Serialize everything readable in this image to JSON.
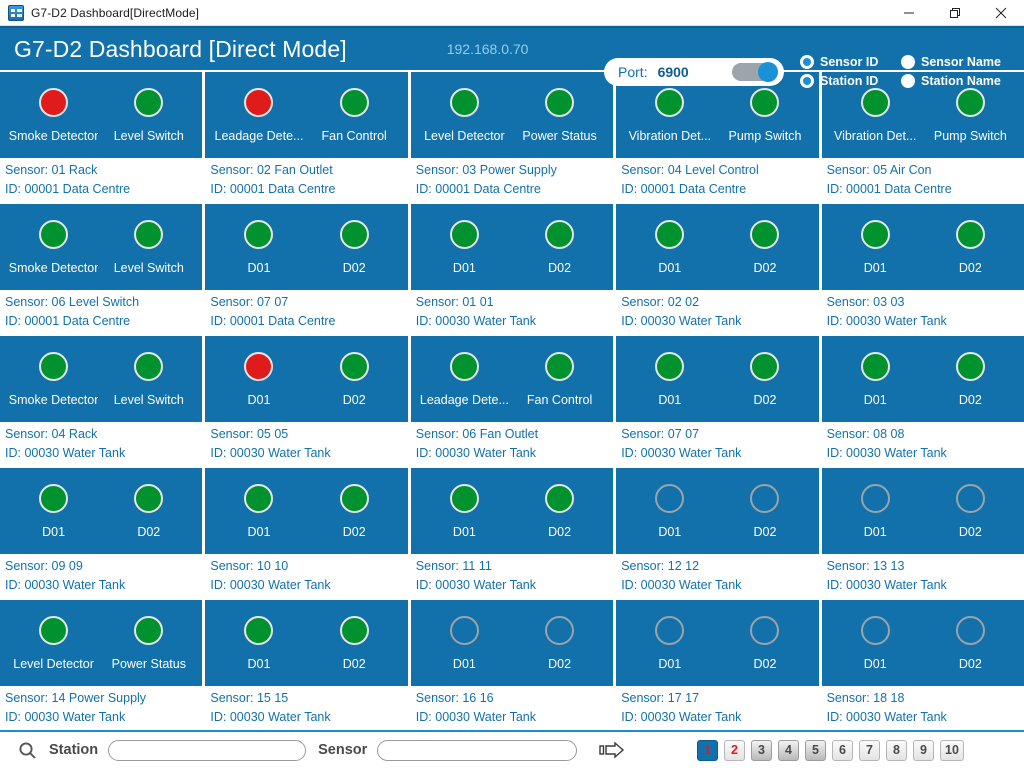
{
  "window": {
    "title": "G7-D2 Dashboard[DirectMode]",
    "app_icon": "app-window-icon",
    "minimize": "minimize-icon",
    "maximize": "maximize-icon",
    "close": "close-icon"
  },
  "header": {
    "title": "G7-D2 Dashboard [Direct Mode]",
    "ip_address": "192.168.0.70",
    "port_label": "Port:",
    "port_value": "6900",
    "port_toggle_on": true,
    "accent_color": "#1271ab",
    "toggle_color": "#1a91d6",
    "radios": [
      {
        "label": "Sensor ID",
        "selected": true
      },
      {
        "label": "Sensor Name",
        "selected": false
      },
      {
        "label": "Station ID",
        "selected": true
      },
      {
        "label": "Station Name",
        "selected": false
      }
    ]
  },
  "status_colors": {
    "on": "#00922f",
    "alarm": "#e01b1b",
    "off": "#9aa4a9"
  },
  "tiles": [
    {
      "channels": [
        {
          "label": "Smoke Detector",
          "state": "alarm"
        },
        {
          "label": "Level Switch",
          "state": "on"
        }
      ],
      "sensor": "Sensor: 01 Rack",
      "id": "ID: 00001 Data Centre"
    },
    {
      "channels": [
        {
          "label": "Leadage Dete...",
          "state": "alarm"
        },
        {
          "label": "Fan Control",
          "state": "on"
        }
      ],
      "sensor": "Sensor: 02 Fan Outlet",
      "id": "ID: 00001 Data Centre"
    },
    {
      "channels": [
        {
          "label": "Level Detector",
          "state": "on"
        },
        {
          "label": "Power Status",
          "state": "on"
        }
      ],
      "sensor": "Sensor: 03 Power Supply",
      "id": "ID: 00001 Data Centre"
    },
    {
      "channels": [
        {
          "label": "Vibration Det...",
          "state": "on"
        },
        {
          "label": "Pump Switch",
          "state": "on"
        }
      ],
      "sensor": "Sensor: 04 Level Control",
      "id": "ID: 00001 Data Centre"
    },
    {
      "channels": [
        {
          "label": "Vibration Det...",
          "state": "on"
        },
        {
          "label": "Pump Switch",
          "state": "on"
        }
      ],
      "sensor": "Sensor: 05 Air Con",
      "id": "ID: 00001 Data Centre"
    },
    {
      "channels": [
        {
          "label": "Smoke Detector",
          "state": "on"
        },
        {
          "label": "Level Switch",
          "state": "on"
        }
      ],
      "sensor": "Sensor: 06 Level Switch",
      "id": "ID: 00001 Data Centre"
    },
    {
      "channels": [
        {
          "label": "D01",
          "state": "on"
        },
        {
          "label": "D02",
          "state": "on"
        }
      ],
      "sensor": "Sensor: 07 07",
      "id": "ID: 00001 Data Centre"
    },
    {
      "channels": [
        {
          "label": "D01",
          "state": "on"
        },
        {
          "label": "D02",
          "state": "on"
        }
      ],
      "sensor": "Sensor: 01 01",
      "id": "ID: 00030 Water Tank"
    },
    {
      "channels": [
        {
          "label": "D01",
          "state": "on"
        },
        {
          "label": "D02",
          "state": "on"
        }
      ],
      "sensor": "Sensor: 02 02",
      "id": "ID: 00030 Water Tank"
    },
    {
      "channels": [
        {
          "label": "D01",
          "state": "on"
        },
        {
          "label": "D02",
          "state": "on"
        }
      ],
      "sensor": "Sensor: 03 03",
      "id": "ID: 00030 Water Tank"
    },
    {
      "channels": [
        {
          "label": "Smoke Detector",
          "state": "on"
        },
        {
          "label": "Level Switch",
          "state": "on"
        }
      ],
      "sensor": "Sensor: 04 Rack",
      "id": "ID: 00030 Water Tank"
    },
    {
      "channels": [
        {
          "label": "D01",
          "state": "alarm"
        },
        {
          "label": "D02",
          "state": "on"
        }
      ],
      "sensor": "Sensor: 05 05",
      "id": "ID: 00030 Water Tank"
    },
    {
      "channels": [
        {
          "label": "Leadage Dete...",
          "state": "on"
        },
        {
          "label": "Fan Control",
          "state": "on"
        }
      ],
      "sensor": "Sensor: 06 Fan Outlet",
      "id": "ID: 00030 Water Tank"
    },
    {
      "channels": [
        {
          "label": "D01",
          "state": "on"
        },
        {
          "label": "D02",
          "state": "on"
        }
      ],
      "sensor": "Sensor: 07 07",
      "id": "ID: 00030 Water Tank"
    },
    {
      "channels": [
        {
          "label": "D01",
          "state": "on"
        },
        {
          "label": "D02",
          "state": "on"
        }
      ],
      "sensor": "Sensor: 08 08",
      "id": "ID: 00030 Water Tank"
    },
    {
      "channels": [
        {
          "label": "D01",
          "state": "on"
        },
        {
          "label": "D02",
          "state": "on"
        }
      ],
      "sensor": "Sensor: 09 09",
      "id": "ID: 00030 Water Tank"
    },
    {
      "channels": [
        {
          "label": "D01",
          "state": "on"
        },
        {
          "label": "D02",
          "state": "on"
        }
      ],
      "sensor": "Sensor: 10 10",
      "id": "ID: 00030 Water Tank"
    },
    {
      "channels": [
        {
          "label": "D01",
          "state": "on"
        },
        {
          "label": "D02",
          "state": "on"
        }
      ],
      "sensor": "Sensor: 11 11",
      "id": "ID: 00030 Water Tank"
    },
    {
      "channels": [
        {
          "label": "D01",
          "state": "off"
        },
        {
          "label": "D02",
          "state": "off"
        }
      ],
      "sensor": "Sensor: 12 12",
      "id": "ID: 00030 Water Tank"
    },
    {
      "channels": [
        {
          "label": "D01",
          "state": "off"
        },
        {
          "label": "D02",
          "state": "off"
        }
      ],
      "sensor": "Sensor: 13 13",
      "id": "ID: 00030 Water Tank"
    },
    {
      "channels": [
        {
          "label": "Level Detector",
          "state": "on"
        },
        {
          "label": "Power Status",
          "state": "on"
        }
      ],
      "sensor": "Sensor: 14 Power Supply",
      "id": "ID: 00030 Water Tank"
    },
    {
      "channels": [
        {
          "label": "D01",
          "state": "on"
        },
        {
          "label": "D02",
          "state": "on"
        }
      ],
      "sensor": "Sensor: 15 15",
      "id": "ID: 00030 Water Tank"
    },
    {
      "channels": [
        {
          "label": "D01",
          "state": "off"
        },
        {
          "label": "D02",
          "state": "off"
        }
      ],
      "sensor": "Sensor: 16 16",
      "id": "ID: 00030 Water Tank"
    },
    {
      "channels": [
        {
          "label": "D01",
          "state": "off"
        },
        {
          "label": "D02",
          "state": "off"
        }
      ],
      "sensor": "Sensor: 17 17",
      "id": "ID: 00030 Water Tank"
    },
    {
      "channels": [
        {
          "label": "D01",
          "state": "off"
        },
        {
          "label": "D02",
          "state": "off"
        }
      ],
      "sensor": "Sensor: 18 18",
      "id": "ID: 00030 Water Tank"
    }
  ],
  "footer": {
    "search_icon": "search-icon",
    "station_label": "Station",
    "station_value": "",
    "station_placeholder": "",
    "sensor_label": "Sensor",
    "sensor_value": "",
    "sensor_placeholder": "",
    "next_icon": "next-arrow-icon",
    "pages": [
      {
        "label": "1",
        "state": "active"
      },
      {
        "label": "2",
        "state": "marked"
      },
      {
        "label": "3",
        "state": "visited"
      },
      {
        "label": "4",
        "state": "visited"
      },
      {
        "label": "5",
        "state": "visited"
      },
      {
        "label": "6",
        "state": "normal"
      },
      {
        "label": "7",
        "state": "normal"
      },
      {
        "label": "8",
        "state": "normal"
      },
      {
        "label": "9",
        "state": "normal"
      },
      {
        "label": "10",
        "state": "normal"
      }
    ]
  }
}
